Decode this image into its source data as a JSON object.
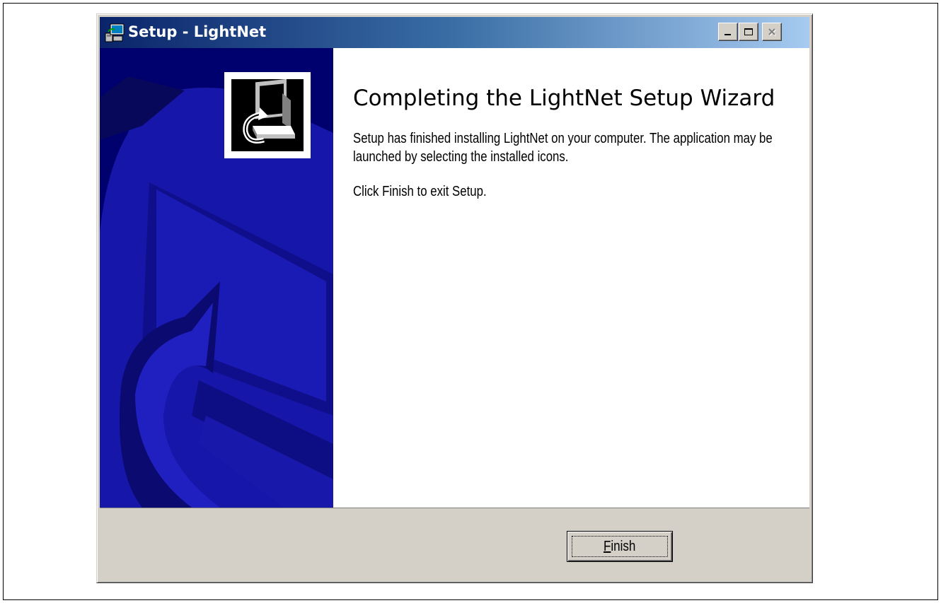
{
  "window": {
    "title": "Setup - LightNet",
    "controls": {
      "minimize_icon": "minimize-icon",
      "maximize_icon": "maximize-icon",
      "close_icon": "close-icon",
      "close_disabled": true
    }
  },
  "wizard": {
    "heading": "Completing the LightNet Setup Wizard",
    "paragraph_1": "Setup has finished installing LightNet on your computer. The application may be launched by selecting the installed icons.",
    "paragraph_2": "Click Finish to exit Setup.",
    "side_image": "setup-computer-image"
  },
  "buttons": {
    "finish": {
      "label_mnemonic": "F",
      "label_rest": "inish"
    }
  },
  "colors": {
    "titlebar_start": "#0a246a",
    "titlebar_end": "#a6caf0",
    "side_panel": "#000060",
    "dialog_face": "#d4d0c8"
  }
}
